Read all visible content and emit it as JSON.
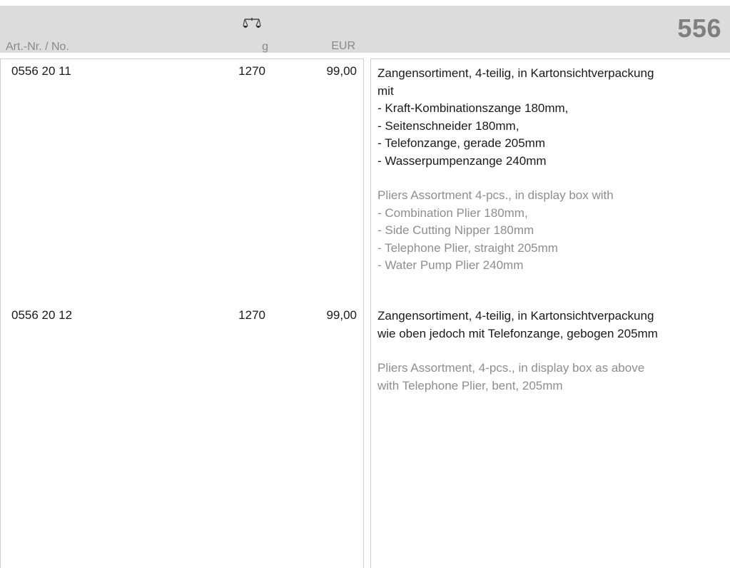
{
  "header": {
    "art_nr_label": "Art.-Nr. / No.",
    "weight_unit": "g",
    "currency": "EUR",
    "page_number": "556",
    "weight_icon": "scale-icon"
  },
  "items": [
    {
      "art_nr": "0556 20 11",
      "weight": "1270",
      "price": "99,00",
      "desc_de": [
        "Zangensortiment, 4-teilig, in Kartonsichtverpackung",
        "mit",
        "- Kraft-Kombinationszange 180mm,",
        "- Seitenschneider 180mm,",
        "- Telefonzange, gerade 205mm",
        "- Wasserpumpenzange 240mm"
      ],
      "desc_en": [
        "Pliers Assortment 4-pcs., in display box with",
        "- Combination Plier 180mm,",
        "- Side Cutting Nipper 180mm",
        "- Telephone Plier, straight 205mm",
        "- Water Pump Plier 240mm"
      ]
    },
    {
      "art_nr": "0556 20 12",
      "weight": "1270",
      "price": "99,00",
      "desc_de": [
        "Zangensortiment, 4-teilig, in Kartonsichtverpackung",
        "wie oben jedoch mit Telefonzange, gebogen 205mm"
      ],
      "desc_en": [
        "Pliers Assortment, 4-pcs., in display box as above",
        "with Telephone Plier, bent, 205mm"
      ]
    }
  ]
}
